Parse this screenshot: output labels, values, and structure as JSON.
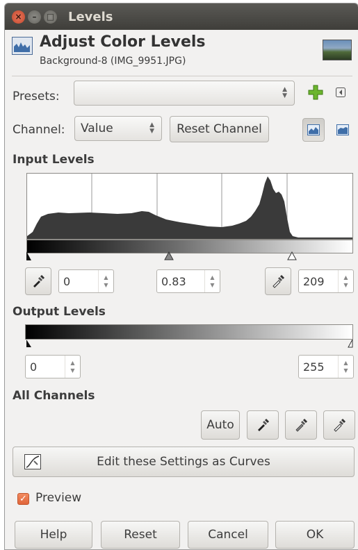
{
  "window": {
    "title": "Levels"
  },
  "header": {
    "title": "Adjust Color Levels",
    "subtitle": "Background-8 (IMG_9951.JPG)"
  },
  "presets": {
    "label": "Presets:",
    "value": ""
  },
  "channel": {
    "label": "Channel:",
    "value": "Value",
    "reset_label": "Reset Channel"
  },
  "input_levels": {
    "heading": "Input Levels",
    "black": "0",
    "gamma": "0.83",
    "white": "209"
  },
  "output_levels": {
    "heading": "Output Levels",
    "low": "0",
    "high": "255"
  },
  "all_channels": {
    "heading": "All Channels",
    "auto_label": "Auto"
  },
  "curves_button": {
    "label": "Edit these Settings as Curves"
  },
  "preview": {
    "label": "Preview",
    "checked": true
  },
  "footer": {
    "help": "Help",
    "reset": "Reset",
    "cancel": "Cancel",
    "ok": "OK"
  },
  "colors": {
    "accent": "#e0653a",
    "titlebar": "#3f3e3a",
    "add_preset": "#6cb52e"
  }
}
